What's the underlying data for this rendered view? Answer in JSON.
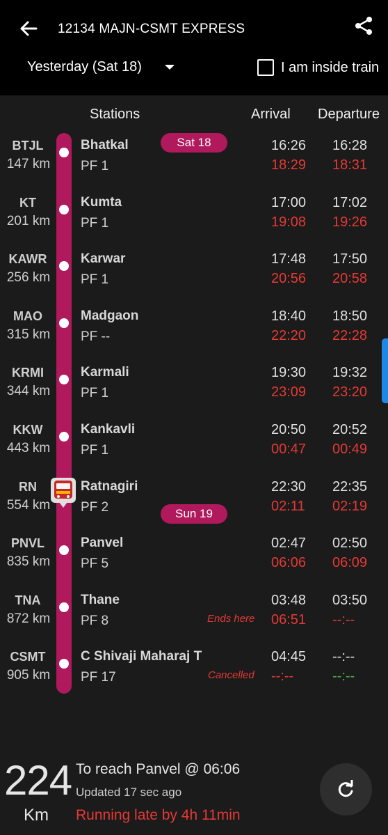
{
  "header": {
    "title": "12134 MAJN-CSMT EXPRESS",
    "date_selector": "Yesterday (Sat 18)",
    "inside_train_label": "I am inside train"
  },
  "columns": {
    "stations": "Stations",
    "arrival": "Arrival",
    "departure": "Departure"
  },
  "day_pills": {
    "first": "Sat 18",
    "second": "Sun 19"
  },
  "stations": [
    {
      "code": "BTJL",
      "km": "147 km",
      "name": "Bhatkal",
      "pf": "PF 1",
      "sched_arr": "16:26",
      "sched_dep": "16:28",
      "act_arr": "18:29",
      "act_dep": "18:31"
    },
    {
      "code": "KT",
      "km": "201 km",
      "name": "Kumta",
      "pf": "PF 1",
      "sched_arr": "17:00",
      "sched_dep": "17:02",
      "act_arr": "19:08",
      "act_dep": "19:26"
    },
    {
      "code": "KAWR",
      "km": "256 km",
      "name": "Karwar",
      "pf": "PF 1",
      "sched_arr": "17:48",
      "sched_dep": "17:50",
      "act_arr": "20:56",
      "act_dep": "20:58"
    },
    {
      "code": "MAO",
      "km": "315 km",
      "name": "Madgaon",
      "pf": "PF --",
      "sched_arr": "18:40",
      "sched_dep": "18:50",
      "act_arr": "22:20",
      "act_dep": "22:28"
    },
    {
      "code": "KRMI",
      "km": "344 km",
      "name": "Karmali",
      "pf": "PF 1",
      "sched_arr": "19:30",
      "sched_dep": "19:32",
      "act_arr": "23:09",
      "act_dep": "23:20"
    },
    {
      "code": "KKW",
      "km": "443 km",
      "name": "Kankavli",
      "pf": "PF 1",
      "sched_arr": "20:50",
      "sched_dep": "20:52",
      "act_arr": "00:47",
      "act_dep": "00:49"
    },
    {
      "code": "RN",
      "km": "554 km",
      "name": "Ratnagiri",
      "pf": "PF 2",
      "sched_arr": "22:30",
      "sched_dep": "22:35",
      "act_arr": "02:11",
      "act_dep": "02:19"
    },
    {
      "code": "PNVL",
      "km": "835 km",
      "name": "Panvel",
      "pf": "PF 5",
      "sched_arr": "02:47",
      "sched_dep": "02:50",
      "act_arr": "06:06",
      "act_dep": "06:09"
    },
    {
      "code": "TNA",
      "km": "872 km",
      "name": "Thane",
      "pf": "PF 8",
      "sched_arr": "03:48",
      "sched_dep": "03:50",
      "act_arr": "06:51",
      "act_dep": "--:--",
      "note": "Ends here"
    },
    {
      "code": "CSMT",
      "km": "905 km",
      "name": "C Shivaji Maharaj T",
      "pf": "PF 17",
      "sched_arr": "04:45",
      "sched_dep": "--:--",
      "act_arr": "--:--",
      "act_dep": "--:--",
      "note": "Cancelled"
    }
  ],
  "footer": {
    "distance": "224",
    "unit": "Km",
    "reach_text": "To reach Panvel @ 06:06",
    "updated": "Updated 17 sec ago",
    "late_text": "Running late by 4h 11min"
  },
  "colors": {
    "accent": "#b0195c",
    "late": "#e53935",
    "scroll": "#1e88e5"
  },
  "icons": {
    "back": "arrow-left-icon",
    "share": "share-icon",
    "train": "train-icon",
    "refresh": "refresh-icon"
  }
}
